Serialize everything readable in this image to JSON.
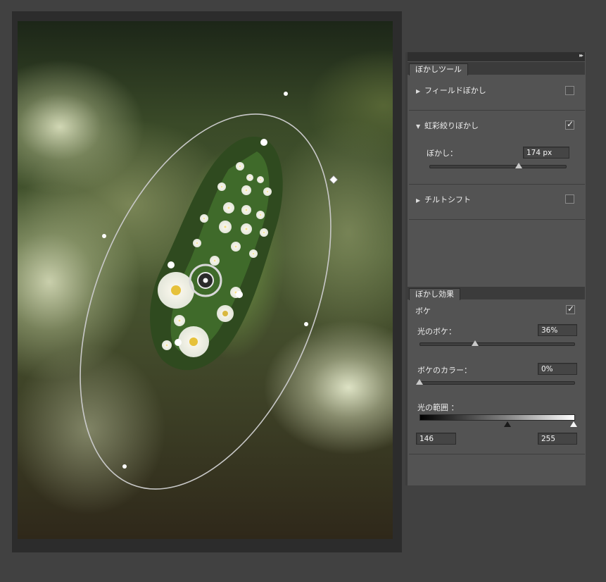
{
  "panel": {
    "blur_tools_tab": "ぼかしツール",
    "field_blur": {
      "label": "フィールドぼかし",
      "checked": false
    },
    "iris_blur": {
      "label": "虹彩絞りぼかし",
      "checked": true,
      "blur_label": "ぼかし：",
      "blur_value": "174 px",
      "blur_fraction": 0.66
    },
    "tilt_shift": {
      "label": "チルトシフト",
      "checked": false
    },
    "blur_effects_tab": "ぼかし効果",
    "bokeh": {
      "label": "ボケ",
      "checked": true,
      "light_bokeh_label": "光のボケ：",
      "light_bokeh_value": "36%",
      "light_bokeh_fraction": 0.36,
      "bokeh_color_label": "ボケのカラー：",
      "bokeh_color_value": "0%",
      "bokeh_color_fraction": 0.0,
      "light_range_label": "光の範囲 ：",
      "light_range_min": "146",
      "light_range_max": "255",
      "light_range_min_fraction": 0.573,
      "light_range_max_fraction": 1.0
    }
  },
  "colors": {
    "panel": "#535353",
    "background": "#414141",
    "accent_check": "#f2f2f2"
  },
  "icons": {
    "collapse": "double-chevron-right-icon",
    "expand": "triangle-right-icon",
    "collapse_open": "triangle-down-icon",
    "check": "checkmark-icon"
  }
}
